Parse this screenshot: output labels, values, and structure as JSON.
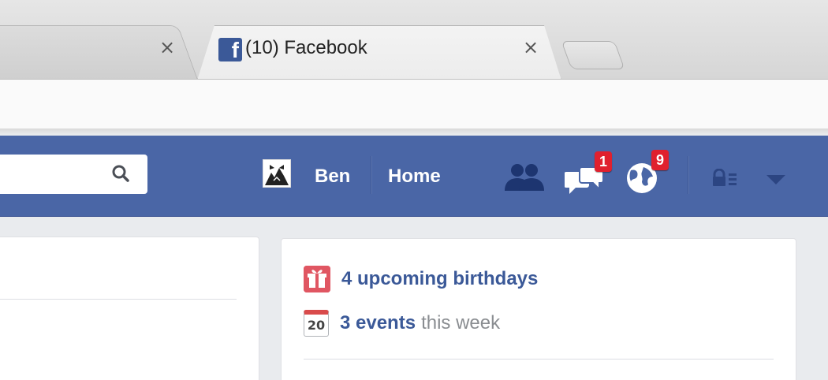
{
  "browser": {
    "tabs": [
      {
        "label": ""
      },
      {
        "label": "(10) Facebook"
      }
    ],
    "close_glyph": "×"
  },
  "facebook": {
    "nav": {
      "user_name": "Ben",
      "home_label": "Home",
      "messages_count": "1",
      "notifications_count": "9"
    },
    "sidebar": {
      "birthdays_text": "4 upcoming birthdays",
      "events_link": "3 events",
      "events_suffix": "this week",
      "calendar_day": "20"
    },
    "colors": {
      "brand_blue": "#4a66a6",
      "link_blue": "#3b5998",
      "badge_red": "#e0202e"
    }
  }
}
